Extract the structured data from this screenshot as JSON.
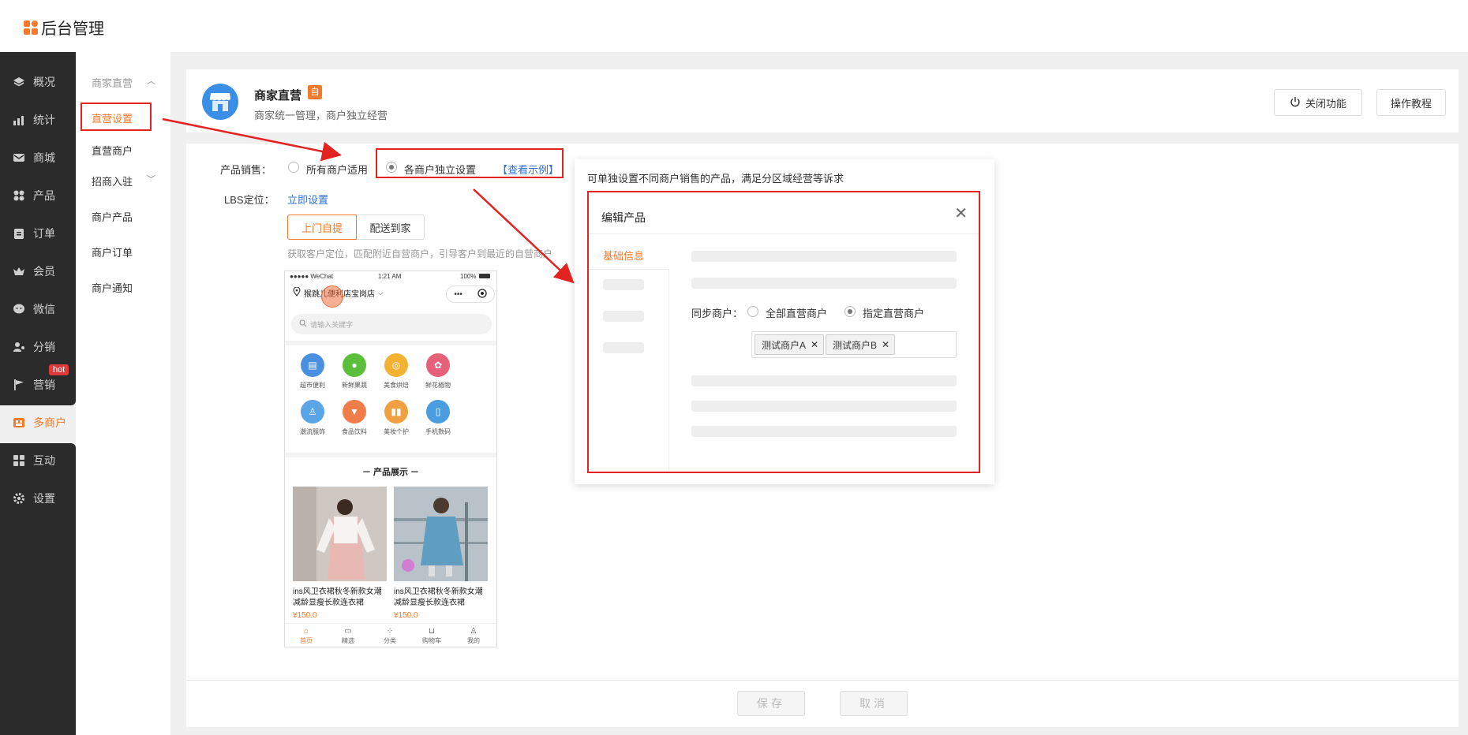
{
  "app": {
    "title": "后台管理"
  },
  "sidebar": {
    "items": [
      {
        "label": "概况",
        "icon": "layers-icon"
      },
      {
        "label": "统计",
        "icon": "chart-icon"
      },
      {
        "label": "商城",
        "icon": "mail-icon"
      },
      {
        "label": "产品",
        "icon": "grid-icon"
      },
      {
        "label": "订单",
        "icon": "clipboard-icon"
      },
      {
        "label": "会员",
        "icon": "crown-icon"
      },
      {
        "label": "微信",
        "icon": "chat-icon"
      },
      {
        "label": "分销",
        "icon": "user-share-icon"
      },
      {
        "label": "营销",
        "icon": "flag-icon"
      },
      {
        "label": "多商户",
        "icon": "store-icon"
      },
      {
        "label": "互动",
        "icon": "grid-icon"
      },
      {
        "label": "设置",
        "icon": "gear-icon"
      }
    ],
    "hot_badge": "hot"
  },
  "subnav": {
    "group1": "商家直营",
    "items": [
      "直营设置",
      "直营商户"
    ],
    "group2": "招商入驻",
    "items2": [
      "商户产品",
      "商户订单",
      "商户通知"
    ]
  },
  "header": {
    "title": "商家直营",
    "badge": "自",
    "subtitle": "商家统一管理，商户独立经营",
    "close_btn": "关闭功能",
    "tutorial_btn": "操作教程"
  },
  "form": {
    "sales_label": "产品销售：",
    "opt_all": "所有商户适用",
    "opt_each": "各商户独立设置",
    "example_link": "【查看示例】",
    "lbs_label": "LBS定位：",
    "lbs_link": "立即设置",
    "tab_pickup": "上门自提",
    "tab_delivery": "配送到家",
    "hint": "获取客户定位，匹配附近自营商户，引导客户到最近的自营商户"
  },
  "phone": {
    "carrier": "●●●●● WeChat",
    "time": "1:21 AM",
    "battery": "100%",
    "store_name": "猴跳儿便利店宝岗店",
    "search_placeholder": "请输入关键字",
    "categories": [
      {
        "label": "超市便利",
        "color": "#4a8fe0"
      },
      {
        "label": "新鲜果蔬",
        "color": "#5cbf3c"
      },
      {
        "label": "美食烘焙",
        "color": "#f2b233"
      },
      {
        "label": "鲜花植物",
        "color": "#e6607a"
      },
      {
        "label": "潮流服饰",
        "color": "#5aa4e8"
      },
      {
        "label": "食品饮料",
        "color": "#f07c4a"
      },
      {
        "label": "美妆个护",
        "color": "#f0a040"
      },
      {
        "label": "手机数码",
        "color": "#4a9ee0"
      }
    ],
    "section_title": "－ 产品展示 －",
    "products": [
      {
        "name": "ins风卫衣裙秋冬新款女潮减龄显瘦长款连衣裙",
        "price": "¥150.0"
      },
      {
        "name": "ins风卫衣裙秋冬新款女潮减龄显瘦长款连衣裙",
        "price": "¥150.0"
      }
    ],
    "tabs": [
      "首页",
      "精选",
      "分类",
      "购物车",
      "我的"
    ]
  },
  "popover": {
    "desc": "可单独设置不同商户销售的产品，满足分区域经营等诉求",
    "modal_title": "编辑产品",
    "tab_basic": "基础信息",
    "sync_label": "同步商户：",
    "opt_all": "全部直营商户",
    "opt_selected": "指定直营商户",
    "tags": [
      "测试商户A",
      "测试商户B"
    ]
  },
  "footer": {
    "save": "保存",
    "cancel": "取消"
  },
  "colors": {
    "accent": "#f5792a",
    "link": "#2f6fd6",
    "highlight": "#e32222",
    "sidebar": "#2b2b2b"
  }
}
